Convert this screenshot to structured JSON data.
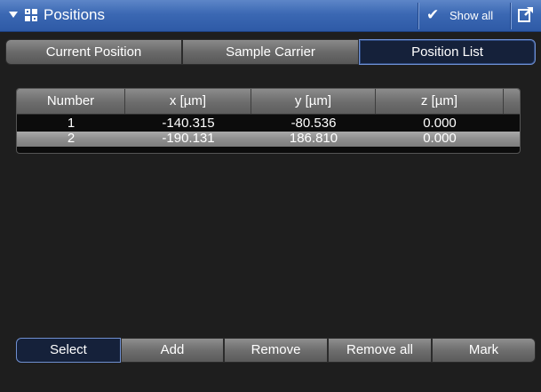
{
  "header": {
    "title": "Positions",
    "show_all_label": "Show all",
    "show_all_checked": true,
    "icons": {
      "collapse": "collapse-arrow-icon",
      "panel": "positions-icon",
      "check": "check-icon",
      "detach": "detach-window-icon"
    }
  },
  "tabs": [
    {
      "label": "Current Position",
      "active": false
    },
    {
      "label": "Sample Carrier",
      "active": false
    },
    {
      "label": "Position List",
      "active": true
    }
  ],
  "table": {
    "columns": [
      "Number",
      "x [µm]",
      "y [µm]",
      "z [µm]"
    ],
    "rows": [
      {
        "number": "1",
        "x": "-140.315",
        "y": "-80.536",
        "z": "0.000",
        "selected": false
      },
      {
        "number": "2",
        "x": "-190.131",
        "y": "186.810",
        "z": "0.000",
        "selected": true
      }
    ]
  },
  "buttons": {
    "select": "Select",
    "add": "Add",
    "remove": "Remove",
    "remove_all": "Remove all",
    "mark": "Mark"
  },
  "colors": {
    "title_bar": "#3b68b3",
    "panel_bg": "#1e1e1e",
    "active_tab_bg": "#15213a",
    "active_tab_border": "#6f8fd0",
    "selected_row": "#8e8e8e"
  }
}
